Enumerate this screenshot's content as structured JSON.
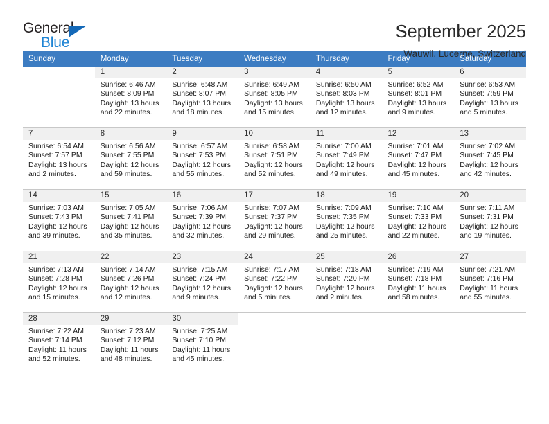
{
  "brand": {
    "name_part1": "General",
    "name_part2": "Blue",
    "accent_color": "#1e84d4",
    "triangle_color": "#1469b8"
  },
  "header": {
    "title": "September 2025",
    "subtitle": "Wauwil, Lucerne, Switzerland"
  },
  "calendar": {
    "header_color": "#3c7cc2",
    "weekday_headers": [
      "Sunday",
      "Monday",
      "Tuesday",
      "Wednesday",
      "Thursday",
      "Friday",
      "Saturday"
    ],
    "weeks": [
      [
        {
          "day": "",
          "sunrise": "",
          "sunset": "",
          "daylight1": "",
          "daylight2": "",
          "blank": true
        },
        {
          "day": "1",
          "sunrise": "Sunrise: 6:46 AM",
          "sunset": "Sunset: 8:09 PM",
          "daylight1": "Daylight: 13 hours",
          "daylight2": "and 22 minutes."
        },
        {
          "day": "2",
          "sunrise": "Sunrise: 6:48 AM",
          "sunset": "Sunset: 8:07 PM",
          "daylight1": "Daylight: 13 hours",
          "daylight2": "and 18 minutes."
        },
        {
          "day": "3",
          "sunrise": "Sunrise: 6:49 AM",
          "sunset": "Sunset: 8:05 PM",
          "daylight1": "Daylight: 13 hours",
          "daylight2": "and 15 minutes."
        },
        {
          "day": "4",
          "sunrise": "Sunrise: 6:50 AM",
          "sunset": "Sunset: 8:03 PM",
          "daylight1": "Daylight: 13 hours",
          "daylight2": "and 12 minutes."
        },
        {
          "day": "5",
          "sunrise": "Sunrise: 6:52 AM",
          "sunset": "Sunset: 8:01 PM",
          "daylight1": "Daylight: 13 hours",
          "daylight2": "and 9 minutes."
        },
        {
          "day": "6",
          "sunrise": "Sunrise: 6:53 AM",
          "sunset": "Sunset: 7:59 PM",
          "daylight1": "Daylight: 13 hours",
          "daylight2": "and 5 minutes."
        }
      ],
      [
        {
          "day": "7",
          "sunrise": "Sunrise: 6:54 AM",
          "sunset": "Sunset: 7:57 PM",
          "daylight1": "Daylight: 13 hours",
          "daylight2": "and 2 minutes."
        },
        {
          "day": "8",
          "sunrise": "Sunrise: 6:56 AM",
          "sunset": "Sunset: 7:55 PM",
          "daylight1": "Daylight: 12 hours",
          "daylight2": "and 59 minutes."
        },
        {
          "day": "9",
          "sunrise": "Sunrise: 6:57 AM",
          "sunset": "Sunset: 7:53 PM",
          "daylight1": "Daylight: 12 hours",
          "daylight2": "and 55 minutes."
        },
        {
          "day": "10",
          "sunrise": "Sunrise: 6:58 AM",
          "sunset": "Sunset: 7:51 PM",
          "daylight1": "Daylight: 12 hours",
          "daylight2": "and 52 minutes."
        },
        {
          "day": "11",
          "sunrise": "Sunrise: 7:00 AM",
          "sunset": "Sunset: 7:49 PM",
          "daylight1": "Daylight: 12 hours",
          "daylight2": "and 49 minutes."
        },
        {
          "day": "12",
          "sunrise": "Sunrise: 7:01 AM",
          "sunset": "Sunset: 7:47 PM",
          "daylight1": "Daylight: 12 hours",
          "daylight2": "and 45 minutes."
        },
        {
          "day": "13",
          "sunrise": "Sunrise: 7:02 AM",
          "sunset": "Sunset: 7:45 PM",
          "daylight1": "Daylight: 12 hours",
          "daylight2": "and 42 minutes."
        }
      ],
      [
        {
          "day": "14",
          "sunrise": "Sunrise: 7:03 AM",
          "sunset": "Sunset: 7:43 PM",
          "daylight1": "Daylight: 12 hours",
          "daylight2": "and 39 minutes."
        },
        {
          "day": "15",
          "sunrise": "Sunrise: 7:05 AM",
          "sunset": "Sunset: 7:41 PM",
          "daylight1": "Daylight: 12 hours",
          "daylight2": "and 35 minutes."
        },
        {
          "day": "16",
          "sunrise": "Sunrise: 7:06 AM",
          "sunset": "Sunset: 7:39 PM",
          "daylight1": "Daylight: 12 hours",
          "daylight2": "and 32 minutes."
        },
        {
          "day": "17",
          "sunrise": "Sunrise: 7:07 AM",
          "sunset": "Sunset: 7:37 PM",
          "daylight1": "Daylight: 12 hours",
          "daylight2": "and 29 minutes."
        },
        {
          "day": "18",
          "sunrise": "Sunrise: 7:09 AM",
          "sunset": "Sunset: 7:35 PM",
          "daylight1": "Daylight: 12 hours",
          "daylight2": "and 25 minutes."
        },
        {
          "day": "19",
          "sunrise": "Sunrise: 7:10 AM",
          "sunset": "Sunset: 7:33 PM",
          "daylight1": "Daylight: 12 hours",
          "daylight2": "and 22 minutes."
        },
        {
          "day": "20",
          "sunrise": "Sunrise: 7:11 AM",
          "sunset": "Sunset: 7:31 PM",
          "daylight1": "Daylight: 12 hours",
          "daylight2": "and 19 minutes."
        }
      ],
      [
        {
          "day": "21",
          "sunrise": "Sunrise: 7:13 AM",
          "sunset": "Sunset: 7:28 PM",
          "daylight1": "Daylight: 12 hours",
          "daylight2": "and 15 minutes."
        },
        {
          "day": "22",
          "sunrise": "Sunrise: 7:14 AM",
          "sunset": "Sunset: 7:26 PM",
          "daylight1": "Daylight: 12 hours",
          "daylight2": "and 12 minutes."
        },
        {
          "day": "23",
          "sunrise": "Sunrise: 7:15 AM",
          "sunset": "Sunset: 7:24 PM",
          "daylight1": "Daylight: 12 hours",
          "daylight2": "and 9 minutes."
        },
        {
          "day": "24",
          "sunrise": "Sunrise: 7:17 AM",
          "sunset": "Sunset: 7:22 PM",
          "daylight1": "Daylight: 12 hours",
          "daylight2": "and 5 minutes."
        },
        {
          "day": "25",
          "sunrise": "Sunrise: 7:18 AM",
          "sunset": "Sunset: 7:20 PM",
          "daylight1": "Daylight: 12 hours",
          "daylight2": "and 2 minutes."
        },
        {
          "day": "26",
          "sunrise": "Sunrise: 7:19 AM",
          "sunset": "Sunset: 7:18 PM",
          "daylight1": "Daylight: 11 hours",
          "daylight2": "and 58 minutes."
        },
        {
          "day": "27",
          "sunrise": "Sunrise: 7:21 AM",
          "sunset": "Sunset: 7:16 PM",
          "daylight1": "Daylight: 11 hours",
          "daylight2": "and 55 minutes."
        }
      ],
      [
        {
          "day": "28",
          "sunrise": "Sunrise: 7:22 AM",
          "sunset": "Sunset: 7:14 PM",
          "daylight1": "Daylight: 11 hours",
          "daylight2": "and 52 minutes."
        },
        {
          "day": "29",
          "sunrise": "Sunrise: 7:23 AM",
          "sunset": "Sunset: 7:12 PM",
          "daylight1": "Daylight: 11 hours",
          "daylight2": "and 48 minutes."
        },
        {
          "day": "30",
          "sunrise": "Sunrise: 7:25 AM",
          "sunset": "Sunset: 7:10 PM",
          "daylight1": "Daylight: 11 hours",
          "daylight2": "and 45 minutes."
        },
        {
          "day": "",
          "sunrise": "",
          "sunset": "",
          "daylight1": "",
          "daylight2": "",
          "blank": true
        },
        {
          "day": "",
          "sunrise": "",
          "sunset": "",
          "daylight1": "",
          "daylight2": "",
          "blank": true
        },
        {
          "day": "",
          "sunrise": "",
          "sunset": "",
          "daylight1": "",
          "daylight2": "",
          "blank": true
        },
        {
          "day": "",
          "sunrise": "",
          "sunset": "",
          "daylight1": "",
          "daylight2": "",
          "blank": true
        }
      ]
    ]
  }
}
